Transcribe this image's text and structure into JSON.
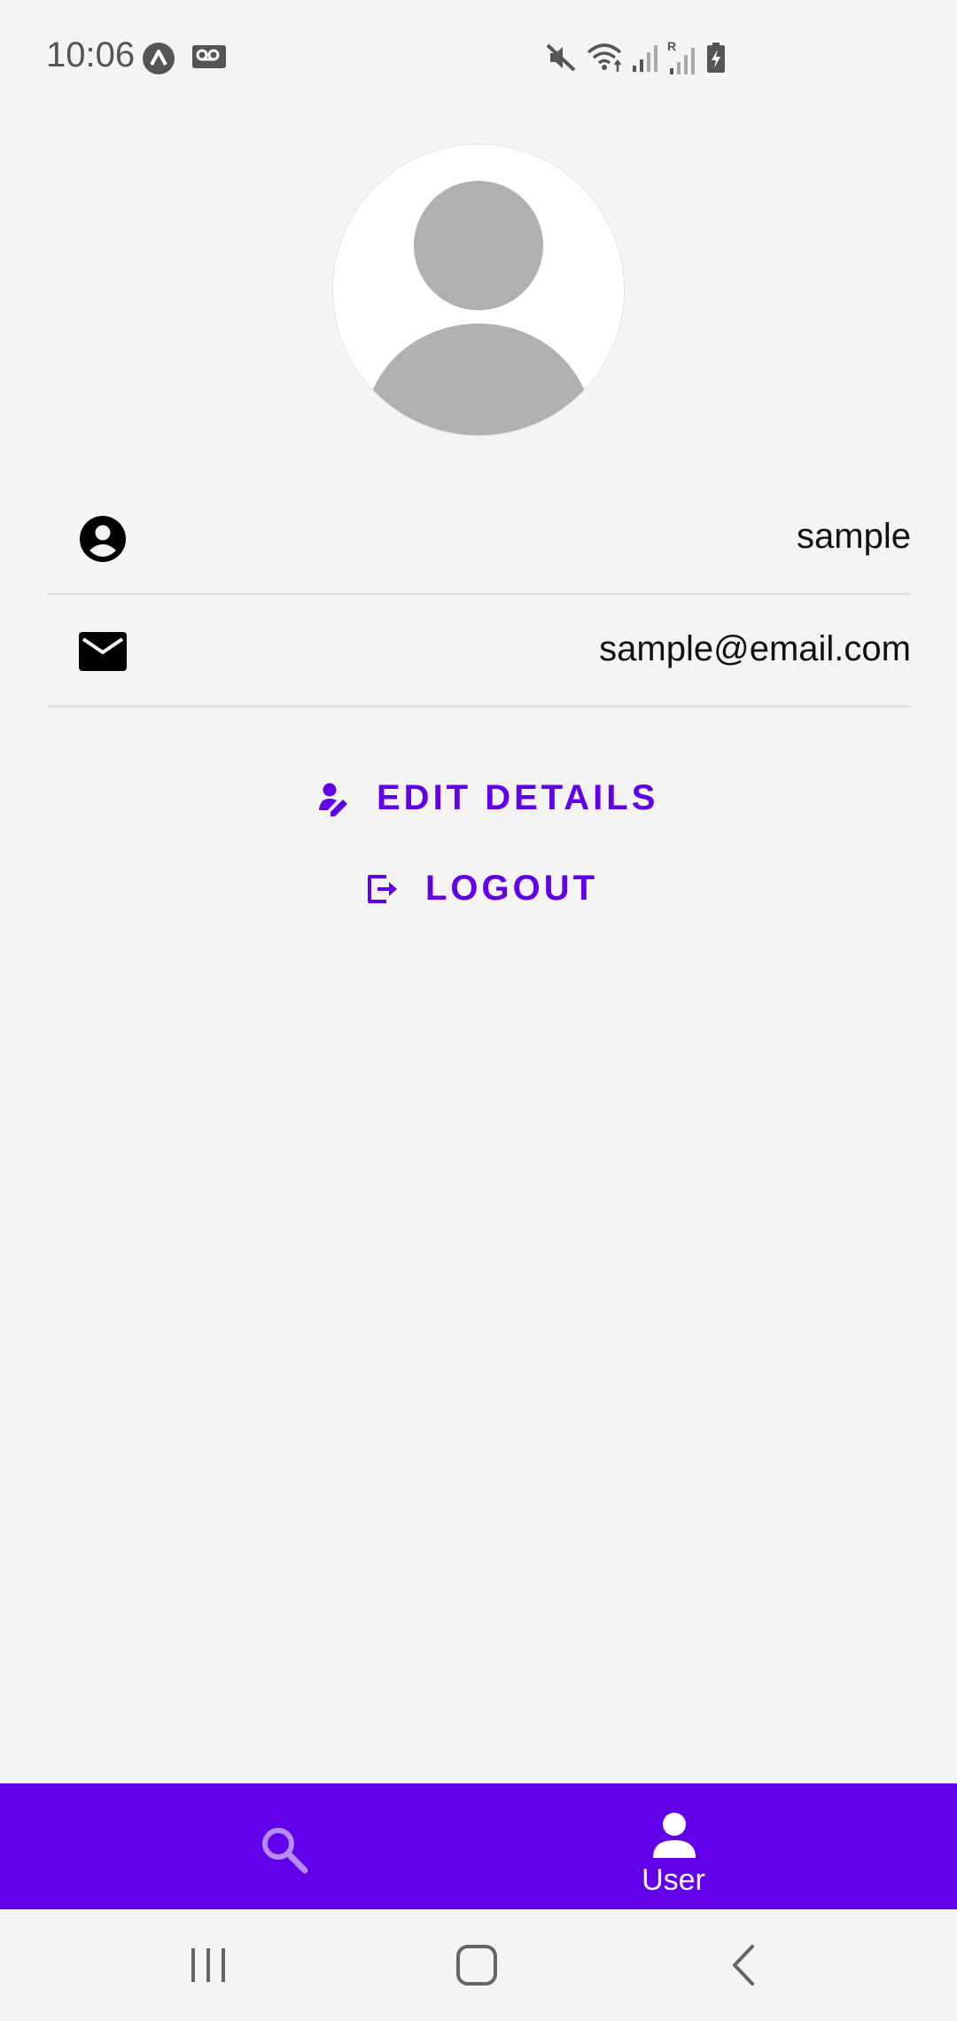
{
  "status_bar": {
    "time": "10:06",
    "left_icons": [
      "expo-icon",
      "voicemail-icon"
    ],
    "right_icons": [
      "mute-icon",
      "wifi-icon",
      "signal-icon",
      "signal-roaming-icon",
      "battery-charging-icon"
    ],
    "roaming_label": "R"
  },
  "profile": {
    "avatar_icon": "default-avatar-icon",
    "username": "sample",
    "email": "sample@email.com",
    "username_icon": "account-circle-icon",
    "email_icon": "mail-icon"
  },
  "actions": {
    "edit_label": "EDIT DETAILS",
    "edit_icon": "user-edit-icon",
    "logout_label": "LOGOUT",
    "logout_icon": "logout-icon"
  },
  "bottom_nav": {
    "items": [
      {
        "icon": "search-icon",
        "label": ""
      },
      {
        "icon": "user-icon",
        "label": "User",
        "active": true
      }
    ]
  },
  "system_nav": [
    "recents-icon",
    "home-icon",
    "back-icon"
  ],
  "colors": {
    "accent": "#6200ea",
    "background": "#f4f4f4",
    "avatar_gray": "#b0b0b0",
    "nav_inactive": "#b48cf2"
  }
}
